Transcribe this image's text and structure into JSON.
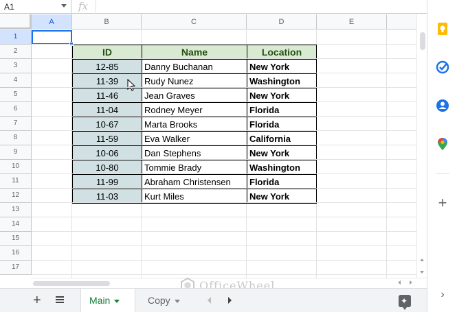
{
  "formula_bar": {
    "cell_ref": "A1",
    "fx_label": "fx"
  },
  "columns": [
    "A",
    "B",
    "C",
    "D",
    "E"
  ],
  "rows": [
    "1",
    "2",
    "3",
    "4",
    "5",
    "6",
    "7",
    "8",
    "9",
    "10",
    "11",
    "12",
    "13",
    "14",
    "15",
    "16",
    "17"
  ],
  "table": {
    "headers": [
      "ID",
      "Name",
      "Location"
    ],
    "rows": [
      [
        "12-85",
        "Danny Buchanan",
        "New York"
      ],
      [
        "11-39",
        "Rudy Nunez",
        "Washington"
      ],
      [
        "11-46",
        "Jean Graves",
        "New York"
      ],
      [
        "11-04",
        "Rodney Meyer",
        "Florida"
      ],
      [
        "10-67",
        "Marta Brooks",
        "Florida"
      ],
      [
        "11-59",
        "Eva Walker",
        "California"
      ],
      [
        "10-06",
        "Dan Stephens",
        "New York"
      ],
      [
        "10-80",
        "Tommie Brady",
        "Washington"
      ],
      [
        "11-99",
        "Abraham Christensen",
        "Florida"
      ],
      [
        "11-03",
        "Kurt Miles",
        "New York"
      ]
    ]
  },
  "sheets": {
    "tabs": [
      "Main",
      "Copy"
    ],
    "active": "Main"
  },
  "watermark": "OfficeWheel",
  "colors": {
    "header_bg": "#d9ead3",
    "header_text": "#274e13",
    "id_bg": "#d0e0e3",
    "selection": "#1a73e8",
    "active_tab": "#188038"
  },
  "side_panel": {
    "icons": [
      "keep-icon",
      "tasks-icon",
      "contacts-icon",
      "maps-icon",
      "add-icon",
      "expand-icon"
    ]
  }
}
